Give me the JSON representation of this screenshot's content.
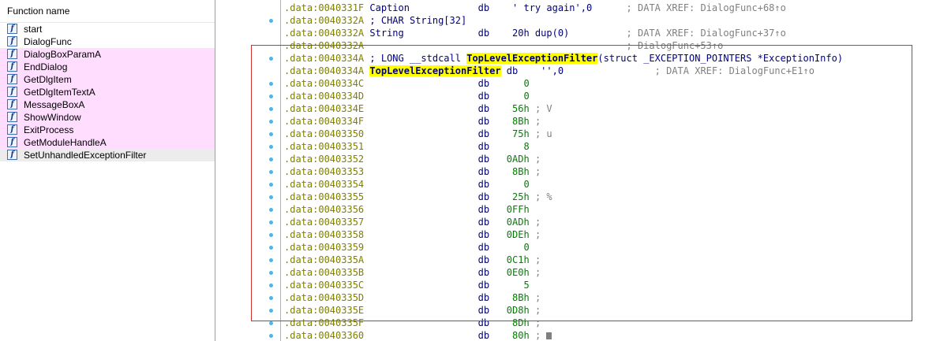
{
  "functions_panel": {
    "header": "Function name",
    "items": [
      {
        "name": "start",
        "kind": "regular"
      },
      {
        "name": "DialogFunc",
        "kind": "regular"
      },
      {
        "name": "DialogBoxParamA",
        "kind": "imported"
      },
      {
        "name": "EndDialog",
        "kind": "imported"
      },
      {
        "name": "GetDlgItem",
        "kind": "imported"
      },
      {
        "name": "GetDlgItemTextA",
        "kind": "imported"
      },
      {
        "name": "MessageBoxA",
        "kind": "imported"
      },
      {
        "name": "ShowWindow",
        "kind": "imported"
      },
      {
        "name": "ExitProcess",
        "kind": "imported"
      },
      {
        "name": "GetModuleHandleA",
        "kind": "imported"
      },
      {
        "name": "SetUnhandledExceptionFilter",
        "kind": "selected"
      }
    ],
    "icon": "function-icon",
    "colors": {
      "imported_bg": "#ffddff",
      "selected_bg": "#ececec"
    }
  },
  "listing": {
    "lines": [
      {
        "addr": ".data:0040331F",
        "label": "Caption",
        "mnem": "db",
        "operand": "' try again',0",
        "comment": "; DATA XREF: DialogFunc+68↑o",
        "dot": false
      },
      {
        "addr": ".data:0040332A",
        "text": "; CHAR String[32]",
        "dot": true
      },
      {
        "addr": ".data:0040332A",
        "label": "String",
        "mnem": "db",
        "operand": "20h dup(0)",
        "comment": "; DATA XREF: DialogFunc+37↑o",
        "dot": false
      },
      {
        "addr": ".data:0040332A",
        "comment": "; DialogFunc+53↑o",
        "dot": false
      },
      {
        "addr": ".data:0040334A",
        "text_pre": "; LONG __stdcall ",
        "highlight": "TopLevelExceptionFilter",
        "text_post": "(struct _EXCEPTION_POINTERS *ExceptionInfo)",
        "dot": true
      },
      {
        "addr": ".data:0040334A",
        "highlight": "TopLevelExceptionFilter",
        "mnem": "db",
        "operand": "'',0",
        "comment": "; DATA XREF: DialogFunc+E1↑o",
        "dot": false
      },
      {
        "addr": ".data:0040334C",
        "mnem": "db",
        "operand": "0",
        "dot": true
      },
      {
        "addr": ".data:0040334D",
        "mnem": "db",
        "operand": "0",
        "dot": true
      },
      {
        "addr": ".data:0040334E",
        "mnem": "db",
        "operand": "56h",
        "comment": "; V",
        "dot": true
      },
      {
        "addr": ".data:0040334F",
        "mnem": "db",
        "operand": "8Bh",
        "comment": ";",
        "dot": true
      },
      {
        "addr": ".data:00403350",
        "mnem": "db",
        "operand": "75h",
        "comment": "; u",
        "dot": true
      },
      {
        "addr": ".data:00403351",
        "mnem": "db",
        "operand": "8",
        "dot": true
      },
      {
        "addr": ".data:00403352",
        "mnem": "db",
        "operand": "0ADh",
        "comment": ";",
        "dot": true
      },
      {
        "addr": ".data:00403353",
        "mnem": "db",
        "operand": "8Bh",
        "comment": ";",
        "dot": true
      },
      {
        "addr": ".data:00403354",
        "mnem": "db",
        "operand": "0",
        "dot": true
      },
      {
        "addr": ".data:00403355",
        "mnem": "db",
        "operand": "25h",
        "comment": "; %",
        "dot": true
      },
      {
        "addr": ".data:00403356",
        "mnem": "db",
        "operand": "0FFh",
        "dot": true
      },
      {
        "addr": ".data:00403357",
        "mnem": "db",
        "operand": "0ADh",
        "comment": ";",
        "dot": true
      },
      {
        "addr": ".data:00403358",
        "mnem": "db",
        "operand": "0DEh",
        "comment": ";",
        "dot": true
      },
      {
        "addr": ".data:00403359",
        "mnem": "db",
        "operand": "0",
        "dot": true
      },
      {
        "addr": ".data:0040335A",
        "mnem": "db",
        "operand": "0C1h",
        "comment": ";",
        "dot": true
      },
      {
        "addr": ".data:0040335B",
        "mnem": "db",
        "operand": "0E0h",
        "comment": ";",
        "dot": true
      },
      {
        "addr": ".data:0040335C",
        "mnem": "db",
        "operand": "5",
        "dot": true
      },
      {
        "addr": ".data:0040335D",
        "mnem": "db",
        "operand": "8Bh",
        "comment": ";",
        "dot": true
      },
      {
        "addr": ".data:0040335E",
        "mnem": "db",
        "operand": "0D8h",
        "comment": ";",
        "dot": true
      },
      {
        "addr": ".data:0040335F",
        "mnem": "db",
        "operand": "8Dh",
        "comment": ";",
        "dot": true
      },
      {
        "addr": ".data:00403360",
        "mnem": "db",
        "operand": "80h",
        "comment": ";",
        "dot": true,
        "caret": true
      }
    ],
    "colors": {
      "address": "#808000",
      "number": "#008000",
      "comment": "#808080",
      "highlight": "#ffff00",
      "dot": "#4fb4e8",
      "selection_border": "#d03030"
    }
  }
}
